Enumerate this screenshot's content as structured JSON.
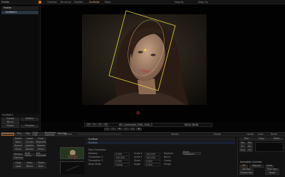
{
  "topbar": {
    "leading_label": "Palette",
    "tabs": [
      "Timeline",
      "Structure",
      "Palettes",
      "Scaffolds",
      "Mixer"
    ],
    "right_tabs": [
      "Magnify",
      "Deep Go"
    ]
  },
  "left_panel": {
    "tree": [
      {
        "label": "Palette"
      },
      {
        "label": "Scaffold 1"
      }
    ],
    "footer_rows": [
      {
        "left": "Scaffold 1",
        "right": ""
      },
      {
        "left": "Create",
        "right": "Delete"
      },
      {
        "left": "Mirror",
        "right": ""
      },
      {
        "left": "Shape",
        "right": "Preview"
      }
    ]
  },
  "transport": {
    "timecode_left": "AE1_horizontal_2560_1440_3",
    "timecode_right": "00:01:18:04",
    "play_buttons": [
      "|<",
      "<",
      ">",
      ">|"
    ],
    "mode_buttons": [
      "Construct",
      "Pins",
      "Rig",
      "Fully Flat",
      "Keyframe Controls",
      "Resolve"
    ]
  },
  "toolbar_strip": {
    "left_label": "Source",
    "mid_label": "Sweep",
    "right_labels": [
      "Range",
      "Levels",
      "Auto",
      "Reset"
    ]
  },
  "bottom": {
    "left_buttons": [
      [
        "Select",
        "Loose",
        "Color"
      ],
      [
        "Warp",
        "Curves",
        "Magnetic"
      ],
      [
        "Stencil",
        "Lighten",
        "Stretch"
      ],
      [
        "Move",
        "Darken",
        "Shear"
      ],
      [
        "Texture",
        "RGB Gains",
        "HSL Equalize"
      ],
      [
        "Camera",
        "",
        ""
      ],
      [
        "Copy",
        "Save",
        "Paste"
      ],
      [
        "Load",
        "Blend",
        "Burn"
      ]
    ],
    "thumbnails": [
      {
        "label": "Source"
      },
      {
        "label": "Result"
      }
    ],
    "section_title": "Scaffold",
    "rows": [
      {
        "label": "Map Translation",
        "value": ""
      },
      {
        "label": "Rotation",
        "value": "0.000"
      },
      {
        "label": "Translation X",
        "value": "100.000"
      },
      {
        "label": "Translation Y",
        "value": "0.000"
      },
      {
        "label": "Wrap Mode",
        "value": "Clamp"
      }
    ],
    "params": [
      {
        "label": "Scale X",
        "value": "100.000"
      },
      {
        "label": "Scale Y",
        "value": "100.000"
      },
      {
        "label": "Shear",
        "value": "0.000"
      },
      {
        "label": "Angle",
        "value": "0.000"
      }
    ],
    "extra_labels": [
      "Rotation",
      "Make Transform",
      "Blend",
      "Clamp",
      "Merge"
    ],
    "right_panel": {
      "tabs": [
        "Trim",
        "Copy",
        "Paste"
      ],
      "buttons": [
        "Pos",
        "Rot",
        "Scl",
        "Shr",
        "Ang",
        "All"
      ],
      "title": "Animation Controls",
      "footer": [
        {
          "label": "Off",
          "value": "Manual",
          "extra": "Auto"
        },
        {
          "label": "Set Key",
          "value": "",
          "extra": "Prev Key"
        },
        {
          "label": "Delete Key",
          "value": "",
          "extra": "Reset"
        }
      ]
    }
  },
  "colors": {
    "bg": "#050505",
    "panel": "#141414",
    "accent_orange": "#c96a1e",
    "rect_yellow": "#e9d23a",
    "pin_red": "#d63b3b"
  }
}
